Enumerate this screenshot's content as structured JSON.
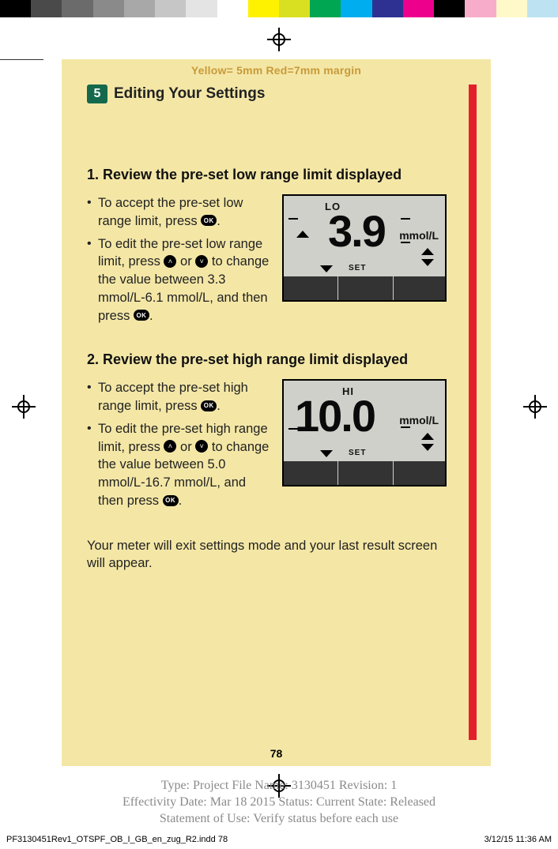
{
  "colorbar": [
    "#000000",
    "#4a4a4a",
    "#6b6b6b",
    "#8a8a8a",
    "#a8a8a8",
    "#c6c6c6",
    "#e4e4e4",
    "#ffffff",
    "#fff200",
    "#d9e021",
    "#00a651",
    "#00aeef",
    "#2e3192",
    "#ec008c",
    "#000000",
    "#f7adc9",
    "#fff9c9",
    "#bde3f2"
  ],
  "margin_note": "Yellow= 5mm  Red=7mm margin",
  "section": {
    "badge": "5",
    "title": "Editing Your Settings"
  },
  "step1": {
    "heading": "1. Review the pre-set low range limit displayed",
    "bullet1_a": "To accept the pre-set low range limit, press ",
    "bullet1_b": ".",
    "bullet2_a": "To edit the pre-set low range limit, press ",
    "bullet2_b": " or ",
    "bullet2_c": " to change the value between 3.3 mmol/L-6.1 mmol/L, and then press ",
    "bullet2_d": ".",
    "lcd": {
      "tag": "LO",
      "value": "3.9",
      "unit": "mmol/L",
      "set": "SET"
    }
  },
  "step2": {
    "heading": "2. Review the pre-set high range limit displayed",
    "bullet1_a": "To accept the pre-set high range limit, press ",
    "bullet1_b": ".",
    "bullet2_a": "To edit the pre-set high range limit, press ",
    "bullet2_b": " or ",
    "bullet2_c": " to change the value between 5.0 mmol/L-16.7 mmol/L, and then press ",
    "bullet2_d": ".",
    "lcd": {
      "tag": "HI",
      "value": "10.0",
      "unit": "mmol/L",
      "set": "SET"
    }
  },
  "closing": "Your meter will exit settings mode and your last result screen will appear.",
  "page_number": "78",
  "meta_line1": "Type: Project File  Name: 3130451  Revision: 1",
  "meta_line2": "Effectivity Date: Mar 18 2015      Status: Current     State: Released",
  "meta_line3": "Statement of Use: Verify status before each use",
  "footer_left": "PF3130451Rev1_OTSPF_OB_I_GB_en_zug_R2.indd   78",
  "footer_right": "3/12/15   11:36 AM",
  "icons": {
    "ok": "OK",
    "up": "˄",
    "down": "˅"
  }
}
